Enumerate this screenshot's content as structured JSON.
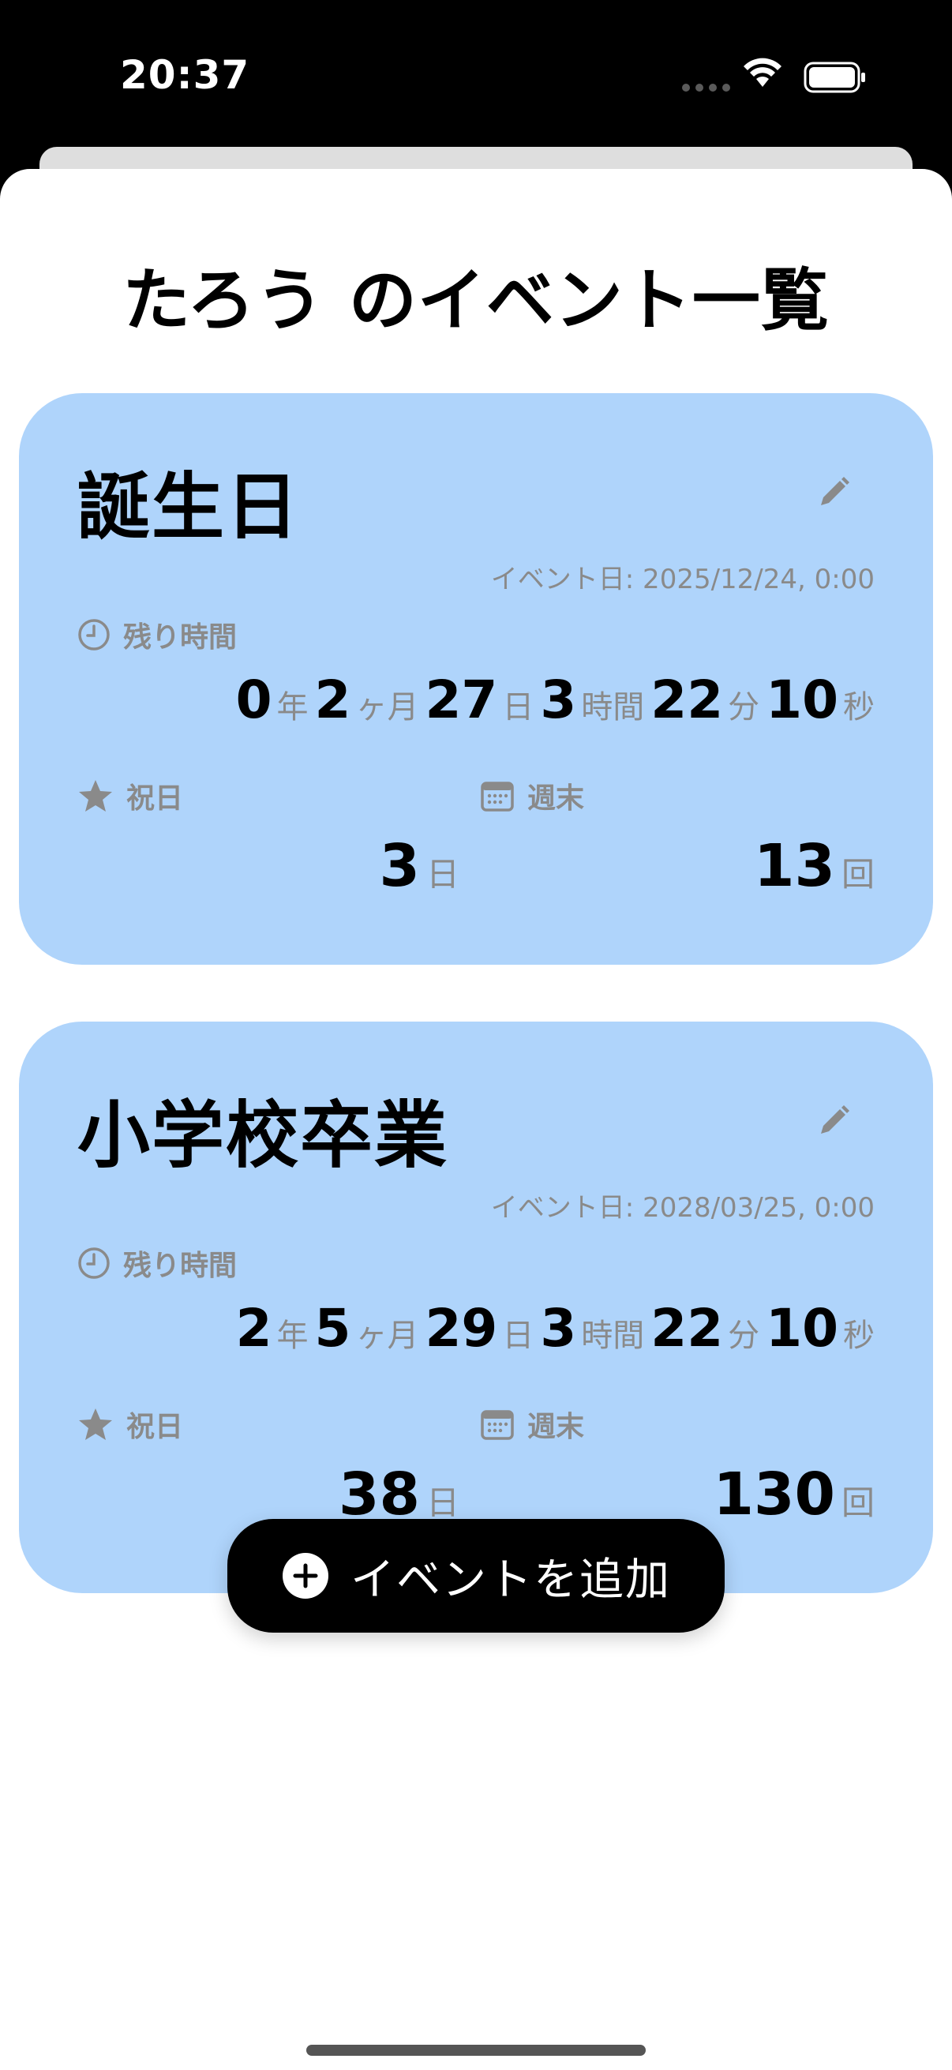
{
  "status_bar": {
    "time": "20:37"
  },
  "page": {
    "title": "たろう のイベント一覧"
  },
  "events": [
    {
      "title": "誕生日",
      "date_text": "イベント日: 2025/12/24, 0:00",
      "remaining_label": "残り時間",
      "countdown": {
        "years": "0",
        "years_unit": "年",
        "months": "2",
        "months_unit": "ヶ月",
        "days": "27",
        "days_unit": "日",
        "hours": "3",
        "hours_unit": "時間",
        "minutes": "22",
        "minutes_unit": "分",
        "seconds": "10",
        "seconds_unit": "秒"
      },
      "holiday_label": "祝日",
      "holiday_count": "3",
      "holiday_unit": "日",
      "weekend_label": "週末",
      "weekend_count": "13",
      "weekend_unit": "回"
    },
    {
      "title": "小学校卒業",
      "date_text": "イベント日: 2028/03/25, 0:00",
      "remaining_label": "残り時間",
      "countdown": {
        "years": "2",
        "years_unit": "年",
        "months": "5",
        "months_unit": "ヶ月",
        "days": "29",
        "days_unit": "日",
        "hours": "3",
        "hours_unit": "時間",
        "minutes": "22",
        "minutes_unit": "分",
        "seconds": "10",
        "seconds_unit": "秒"
      },
      "holiday_label": "祝日",
      "holiday_count": "38",
      "holiday_unit": "日",
      "weekend_label": "週末",
      "weekend_count": "130",
      "weekend_unit": "回"
    }
  ],
  "add_button": {
    "label": "イベントを追加"
  },
  "colors": {
    "card_background": "#afd4fb",
    "secondary_text": "#8a8a8a",
    "button_background": "#000000"
  }
}
